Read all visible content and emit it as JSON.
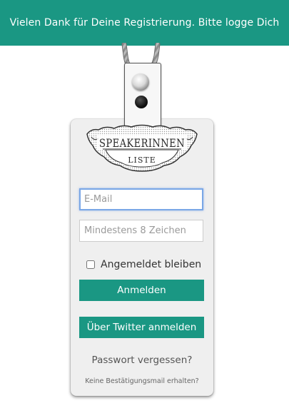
{
  "flash": {
    "message": "Vielen Dank für Deine Registrierung. Bitte logge Dich ein."
  },
  "logo": {
    "line1": "SPEAKERINNEN",
    "line2": "LISTE"
  },
  "form": {
    "email_placeholder": "E-Mail",
    "email_value": "",
    "password_placeholder": "Mindestens 8 Zeichen",
    "password_value": "",
    "remember_label": "Angemeldet bleiben",
    "remember_checked": false,
    "login_label": "Anmelden",
    "twitter_label": "Über Twitter anmelden",
    "forgot_label": "Passwort vergessen?",
    "no_mail_label": "Keine Bestätigungsmail erhalten?"
  },
  "colors": {
    "accent": "#1a9783",
    "focus_border": "#7aa7e6",
    "badge_bg": "#efefef"
  },
  "icons": {
    "lanyard": "lanyard-rope-icon",
    "ring": "metal-ring-icon",
    "hole": "punch-hole-icon"
  }
}
